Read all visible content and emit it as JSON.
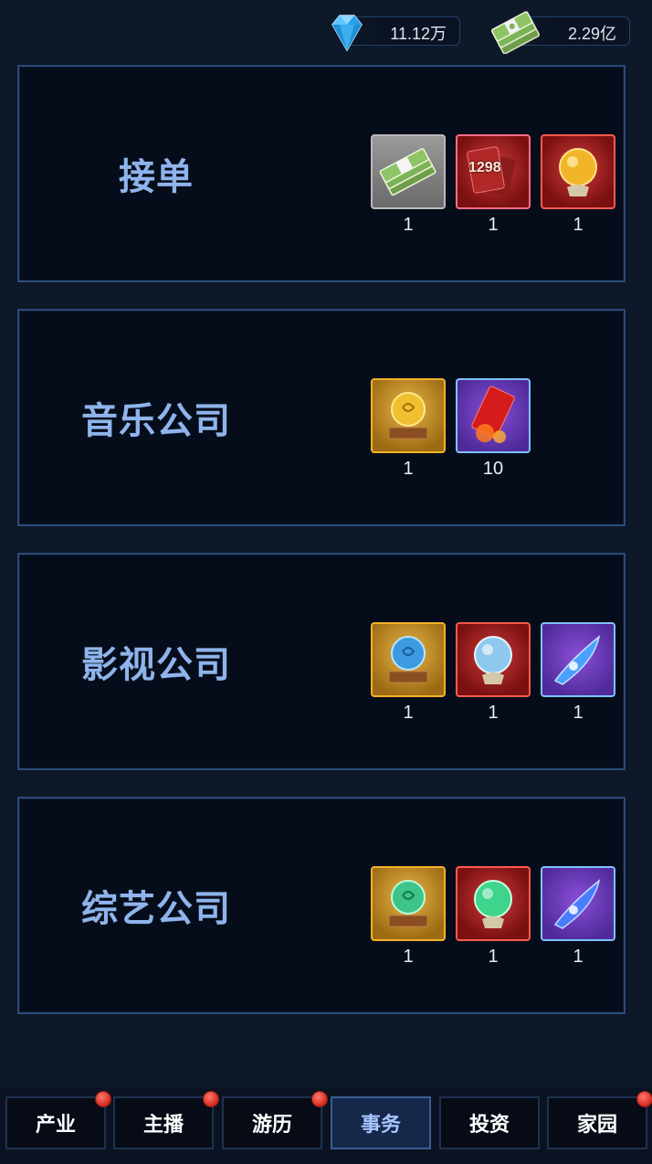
{
  "currencies": {
    "diamond": {
      "value": "11.12万",
      "icon": "diamond-icon"
    },
    "cash": {
      "value": "2.29亿",
      "icon": "cash-stack-icon"
    }
  },
  "panels": [
    {
      "title": "接单",
      "rewards": [
        {
          "icon": "cash-stack-icon",
          "count": "1"
        },
        {
          "icon": "red-card-1298-icon",
          "label": "1298",
          "count": "1"
        },
        {
          "icon": "golden-crystal-ball-icon",
          "count": "1"
        }
      ]
    },
    {
      "title": "音乐公司",
      "rewards": [
        {
          "icon": "gold-orb-on-pedestal-icon",
          "count": "1"
        },
        {
          "icon": "red-envelope-icon",
          "count": "10"
        }
      ]
    },
    {
      "title": "影视公司",
      "rewards": [
        {
          "icon": "blue-orb-on-pedestal-icon",
          "count": "1"
        },
        {
          "icon": "blue-crystal-ball-icon",
          "count": "1"
        },
        {
          "icon": "blue-feather-icon",
          "count": "1"
        }
      ]
    },
    {
      "title": "综艺公司",
      "rewards": [
        {
          "icon": "green-orb-on-pedestal-icon",
          "count": "1"
        },
        {
          "icon": "green-crystal-ball-icon",
          "count": "1"
        },
        {
          "icon": "blue-feather-icon",
          "count": "1"
        }
      ]
    }
  ],
  "nav": [
    {
      "label": "产业",
      "badge": true
    },
    {
      "label": "主播",
      "badge": true
    },
    {
      "label": "游历",
      "badge": true
    },
    {
      "label": "事务",
      "badge": false,
      "active": true
    },
    {
      "label": "投资",
      "badge": false
    },
    {
      "label": "家园",
      "badge": true
    }
  ]
}
